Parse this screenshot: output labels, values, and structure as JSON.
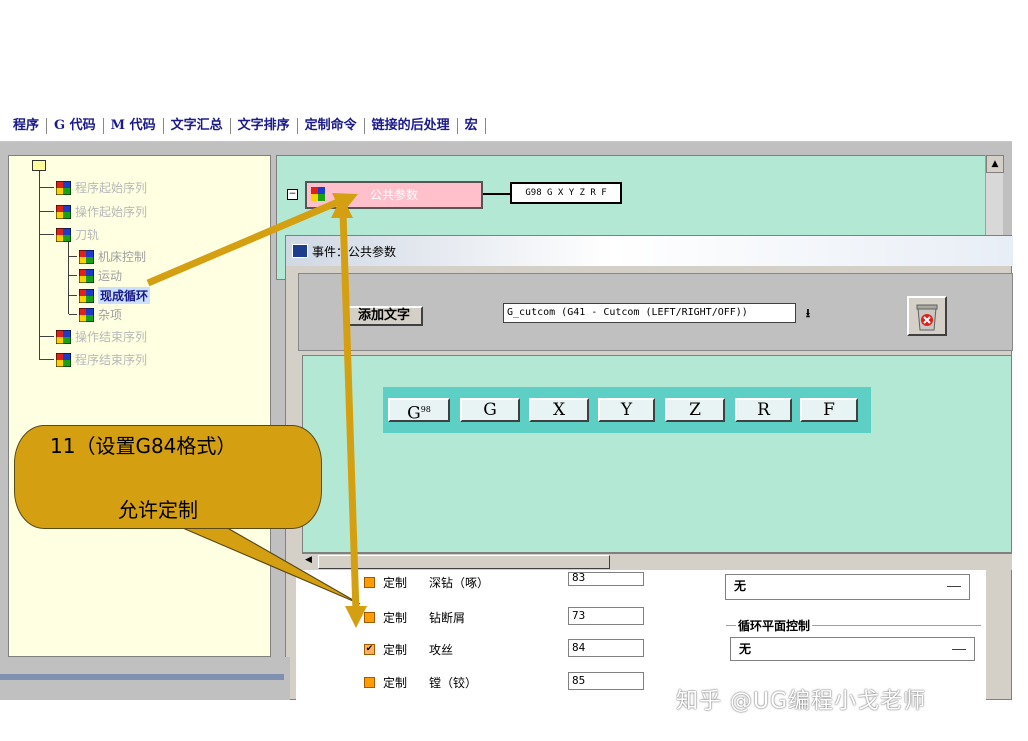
{
  "tabs": [
    "程序",
    "G 代码",
    "M 代码",
    "文字汇总",
    "文字排序",
    "定制命令",
    "链接的后处理",
    "宏"
  ],
  "tree": {
    "items": [
      {
        "label": "程序起始序列"
      },
      {
        "label": "操作起始序列"
      },
      {
        "label": "刀轨"
      },
      {
        "label": "机床控制"
      },
      {
        "label": "运动"
      },
      {
        "label": "现成循环"
      },
      {
        "label": "杂项"
      },
      {
        "label": "操作结束序列"
      },
      {
        "label": "程序结束序列"
      }
    ]
  },
  "event_block": {
    "label": "公共参数",
    "output": "G98 G X Y Z R F"
  },
  "dialog": {
    "title": "事件：公共参数",
    "add_text_button": "添加文字",
    "word_select_value": "G_cutcom (G41 - Cutcom (LEFT/RIGHT/OFF))",
    "delete_icon": "trash-delete-icon",
    "words": [
      "G",
      "G",
      "X",
      "Y",
      "Z",
      "R",
      "F"
    ],
    "first_word_superscript": "98"
  },
  "cycles": {
    "rows": [
      {
        "custom_label": "定制",
        "name": "深钻（啄）",
        "value": "83",
        "checked": false
      },
      {
        "custom_label": "定制",
        "name": "钻断屑",
        "value": "73",
        "checked": false
      },
      {
        "custom_label": "定制",
        "name": "攻丝",
        "value": "84",
        "checked": true
      },
      {
        "custom_label": "定制",
        "name": "镗（铰）",
        "value": "85",
        "checked": false
      }
    ],
    "top_select_value": "无",
    "plane_group_label": "循环平面控制",
    "plane_select_value": "无"
  },
  "callout": {
    "line1": "11（设置G84格式）",
    "line2": "允许定制"
  },
  "watermark": "知乎 @UG编程小戈老师",
  "colors": {
    "tab_text": "#1a1a8a",
    "tree_bg": "#ffffe2",
    "canvas_bg": "#b2e8d4",
    "word_row_bg": "#5ecfc4",
    "event_box": "#ffc0cb",
    "callout_fill": "#d4a012",
    "arrow": "#d4a012",
    "checkbox": "#ff9c00"
  }
}
